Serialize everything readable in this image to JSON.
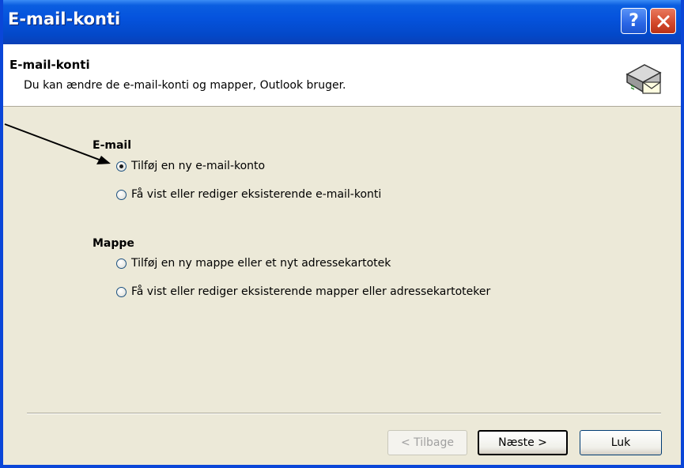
{
  "window": {
    "title": "E-mail-konti",
    "help_label": "?",
    "close_icon": "close-x-icon"
  },
  "header": {
    "title": "E-mail-konti",
    "subtitle": "Du kan ændre de e-mail-konti og mapper, Outlook bruger.",
    "icon": "mail-server-envelope-icon"
  },
  "email_section": {
    "heading": "E-mail",
    "options": [
      {
        "label": "Tilføj en ny e-mail-konto",
        "checked": true
      },
      {
        "label": "Få vist eller rediger eksisterende e-mail-konti",
        "checked": false
      }
    ]
  },
  "folder_section": {
    "heading": "Mappe",
    "options": [
      {
        "label": "Tilføj en ny mappe eller et nyt adressekartotek",
        "checked": false
      },
      {
        "label": "Få vist eller rediger eksisterende mapper eller adressekartoteker",
        "checked": false
      }
    ]
  },
  "buttons": {
    "back": "< Tilbage",
    "next": "Næste >",
    "close": "Luk"
  },
  "colors": {
    "titlebar": "#0553dd",
    "dialog_bg": "#ece9d8",
    "header_bg": "#ffffff",
    "annotation_arrow": "#000000"
  }
}
